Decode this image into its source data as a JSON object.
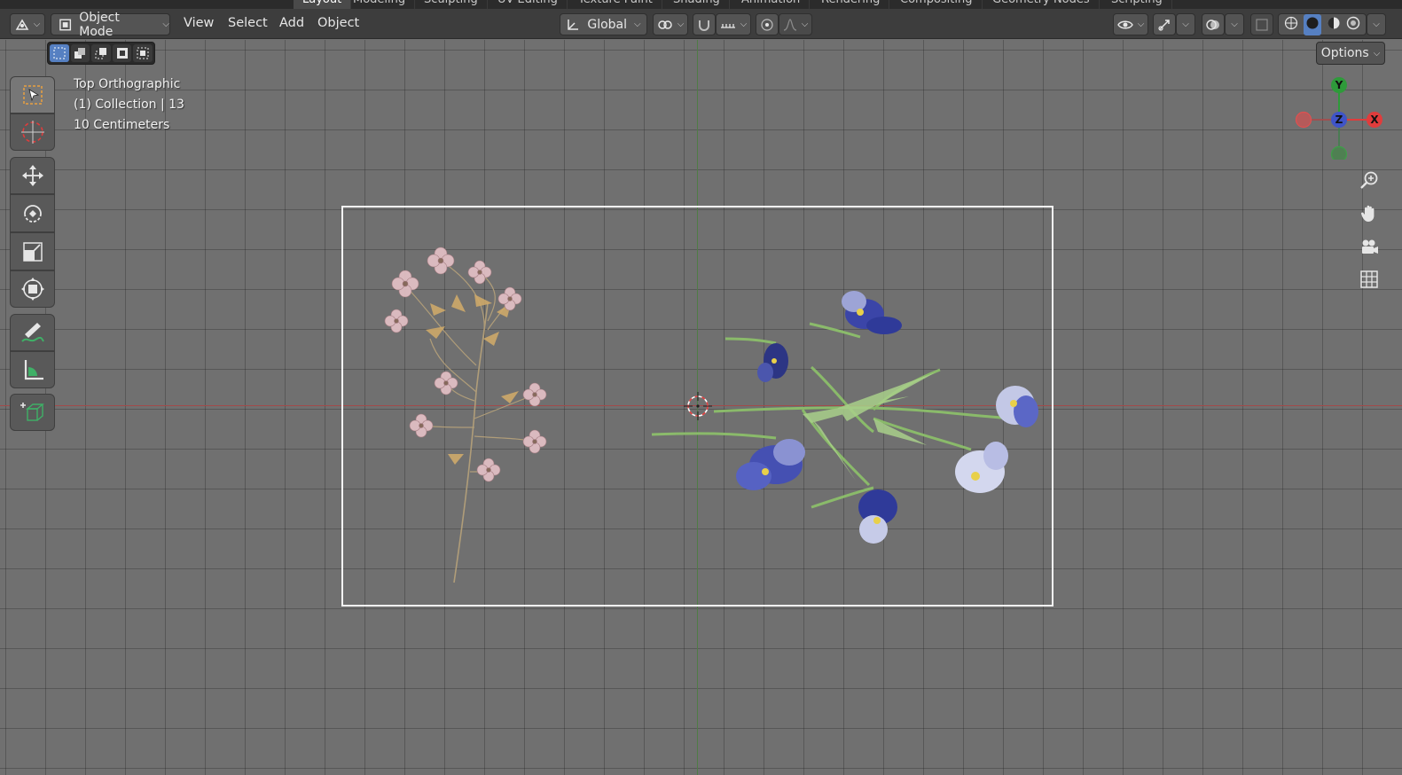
{
  "workspace_tabs": [
    "Layout",
    "Modeling",
    "Sculpting",
    "UV Editing",
    "Texture Paint",
    "Shading",
    "Animation",
    "Rendering",
    "Compositing",
    "Geometry Nodes",
    "Scripting"
  ],
  "workspace_active": "Layout",
  "header": {
    "mode_label": "Object Mode",
    "menus": [
      "View",
      "Select",
      "Add",
      "Object"
    ],
    "orientation_label": "Global"
  },
  "viewport": {
    "view_name": "Top Orthographic",
    "collection_info": "(1) Collection | 13",
    "scale_info": "10 Centimeters",
    "options_label": "Options"
  },
  "gizmo": {
    "y_label": "Y",
    "x_label": "X",
    "z_label": "Z"
  },
  "colors": {
    "header_bg": "#3d3d3d",
    "viewport_bg": "#707070",
    "axis_x": "#a24a4a",
    "axis_y": "#4f7b46",
    "gizmo_x": "#e03c3c",
    "gizmo_y": "#2e9a3a",
    "gizmo_z": "#3f54c8",
    "selection_blue": "#5680c2"
  },
  "icons": {
    "toolbar": [
      "select-box-icon",
      "cursor-icon",
      "move-icon",
      "rotate-icon",
      "scale-icon",
      "transform-icon",
      "annotate-icon",
      "measure-icon",
      "add-cube-icon"
    ],
    "navigation": [
      "zoom-icon",
      "pan-hand-icon",
      "camera-view-icon",
      "grid-view-icon"
    ]
  }
}
